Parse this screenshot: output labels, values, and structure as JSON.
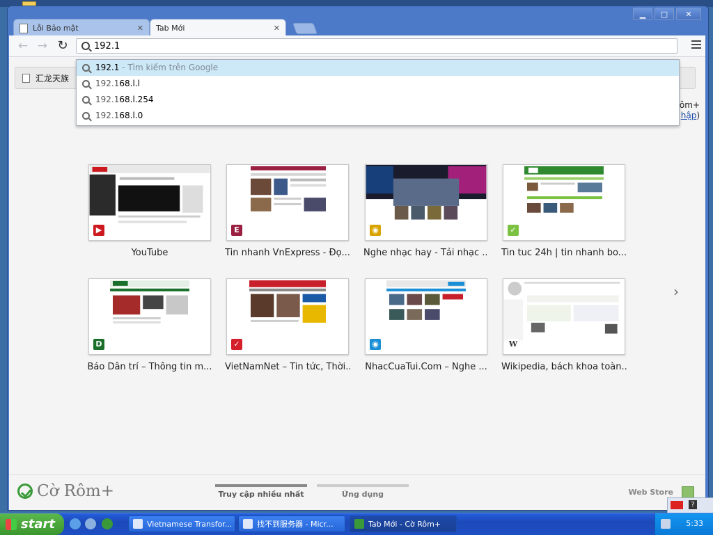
{
  "window": {
    "minimize_glyph": "▁",
    "maximize_glyph": "□",
    "close_glyph": "✕"
  },
  "tabs": [
    {
      "label": "Lỗi Bảo mật",
      "close": "✕"
    },
    {
      "label": "Tab Mới",
      "close": "✕"
    }
  ],
  "toolbar": {
    "back_glyph": "←",
    "forward_glyph": "→",
    "reload_glyph": "↻",
    "omnibox_value": "192.1"
  },
  "autocomplete": [
    {
      "query": "192.1",
      "hint": " - Tìm kiếm trên Google"
    },
    {
      "typed": "192.1",
      "completion": "68.l.l"
    },
    {
      "typed": "192.1",
      "completion": "68.l.254"
    },
    {
      "typed": "192.1",
      "completion": "68.l.0"
    }
  ],
  "bookmarks": [
    {
      "label": "汇龙天族"
    }
  ],
  "signin": {
    "line1": "ôm+",
    "line2_link": "hập",
    "line2_close": ")"
  },
  "most_visited": [
    {
      "title": "YouTube",
      "favicon": "▶",
      "color": "#cc181e"
    },
    {
      "title": "Tin nhanh VnExpress - Đọ...",
      "favicon": "E",
      "color": "#9a1f40"
    },
    {
      "title": "Nghe nhạc hay - Tải nhạc ...",
      "favicon": "◉",
      "color": "#d7a400"
    },
    {
      "title": "Tin tuc 24h | tin nhanh bo...",
      "favicon": "✓",
      "color": "#7cc242"
    },
    {
      "title": "Báo Dân trí – Thông tin m...",
      "favicon": "D",
      "color": "#1a6f2b"
    },
    {
      "title": "VietNamNet – Tin tức, Thời...",
      "favicon": "✓",
      "color": "#d3202a"
    },
    {
      "title": "NhacCuaTui.Com – Nghe ...",
      "favicon": "◉",
      "color": "#1b8fd6"
    },
    {
      "title": "Wikipedia, bách khoa toàn...",
      "favicon": "W",
      "color": "#333333"
    }
  ],
  "pager": {
    "next_glyph": "›"
  },
  "bottom": {
    "logo_text": "Cờ Rôm+",
    "sections": [
      "Truy cập nhiều nhất",
      "Ứng dụng"
    ],
    "webstore": "Web Store"
  },
  "taskbar": {
    "start_label": "start",
    "tasks": [
      {
        "label": "Vietnamese Transfor..."
      },
      {
        "label": "找不到服务器 - Micr..."
      },
      {
        "label": "Tab Mới - Cờ Rôm+"
      }
    ],
    "clock": "5:33",
    "lang_help": "?"
  }
}
